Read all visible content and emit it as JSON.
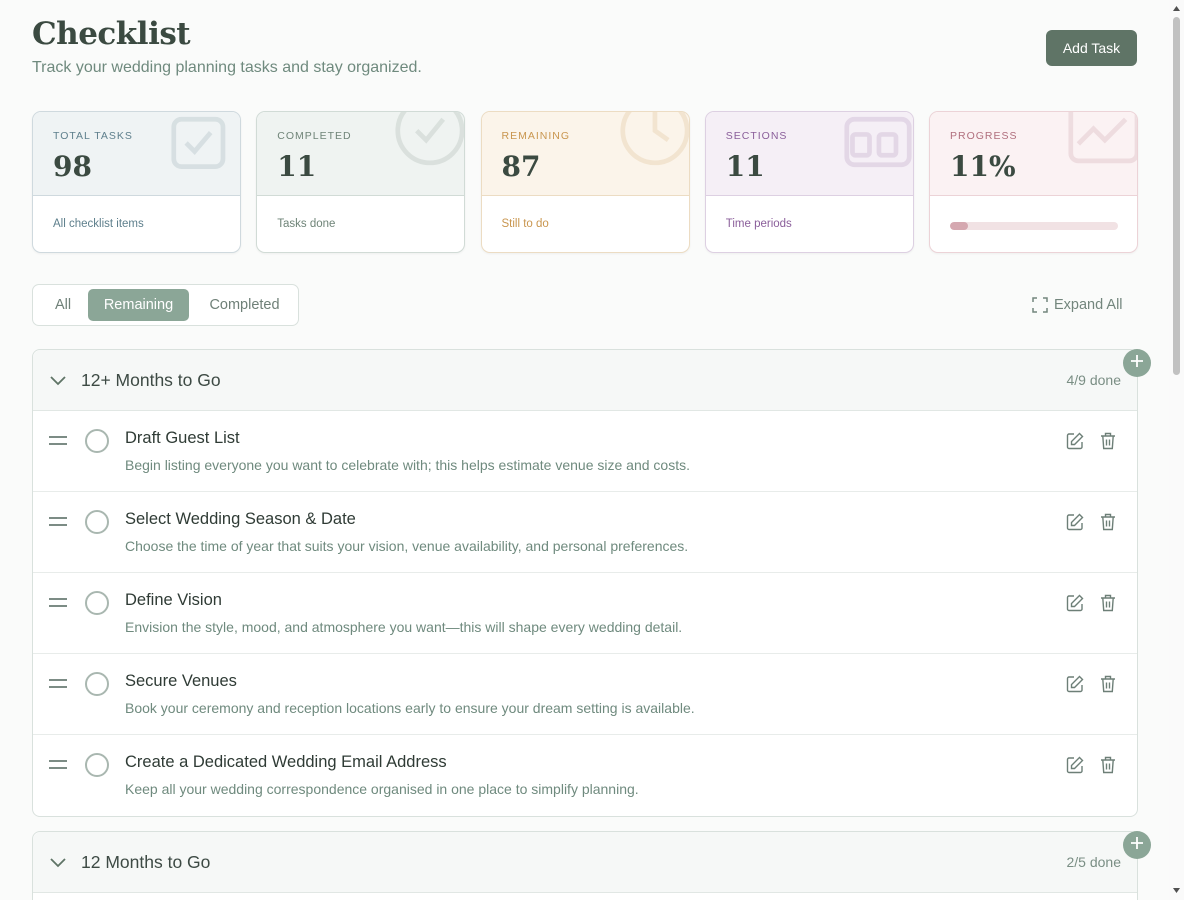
{
  "header": {
    "title": "Checklist",
    "subtitle": "Track your wedding planning tasks and stay organized.",
    "add_task_label": "Add Task"
  },
  "stats": [
    {
      "label": "TOTAL TASKS",
      "value": "98",
      "note": "All checklist items",
      "icon": "checkbox-icon",
      "accent": "#5e7f8c",
      "bg": "#eff3f4",
      "border": "#cfd9de"
    },
    {
      "label": "COMPLETED",
      "value": "11",
      "note": "Tasks done",
      "icon": "check-circle-icon",
      "accent": "#6f8478",
      "bg": "#eff3f1",
      "border": "#d1dbd6"
    },
    {
      "label": "REMAINING",
      "value": "87",
      "note": "Still to do",
      "icon": "clock-icon",
      "accent": "#c9964f",
      "bg": "#fbf4ea",
      "border": "#ecdcc3"
    },
    {
      "label": "SECTIONS",
      "value": "11",
      "note": "Time periods",
      "icon": "calendar-icon",
      "accent": "#8a5e9a",
      "bg": "#f5eff6",
      "border": "#ddd0e2"
    },
    {
      "label": "PROGRESS",
      "value": "11%",
      "progress": 0.11,
      "icon": "trend-icon",
      "accent": "#b06f7d",
      "bg": "#fbf2f3",
      "border": "#ecd3d7"
    }
  ],
  "filters": {
    "options": [
      "All",
      "Remaining",
      "Completed"
    ],
    "active": "Remaining",
    "expand_all_label": "Expand All"
  },
  "sections": [
    {
      "title": "12+ Months to Go",
      "count": "4/9 done",
      "tasks": [
        {
          "title": "Draft Guest List",
          "description": "Begin listing everyone you want to celebrate with; this helps estimate venue size and costs."
        },
        {
          "title": "Select Wedding Season & Date",
          "description": "Choose the time of year that suits your vision, venue availability, and personal preferences."
        },
        {
          "title": "Define Vision",
          "description": "Envision the style, mood, and atmosphere you want—this will shape every wedding detail."
        },
        {
          "title": "Secure Venues",
          "description": "Book your ceremony and reception locations early to ensure your dream setting is available."
        },
        {
          "title": "Create a Dedicated Wedding Email Address",
          "description": "Keep all your wedding correspondence organised in one place to simplify planning."
        }
      ]
    },
    {
      "title": "12 Months to Go",
      "count": "2/5 done",
      "tasks": []
    }
  ]
}
